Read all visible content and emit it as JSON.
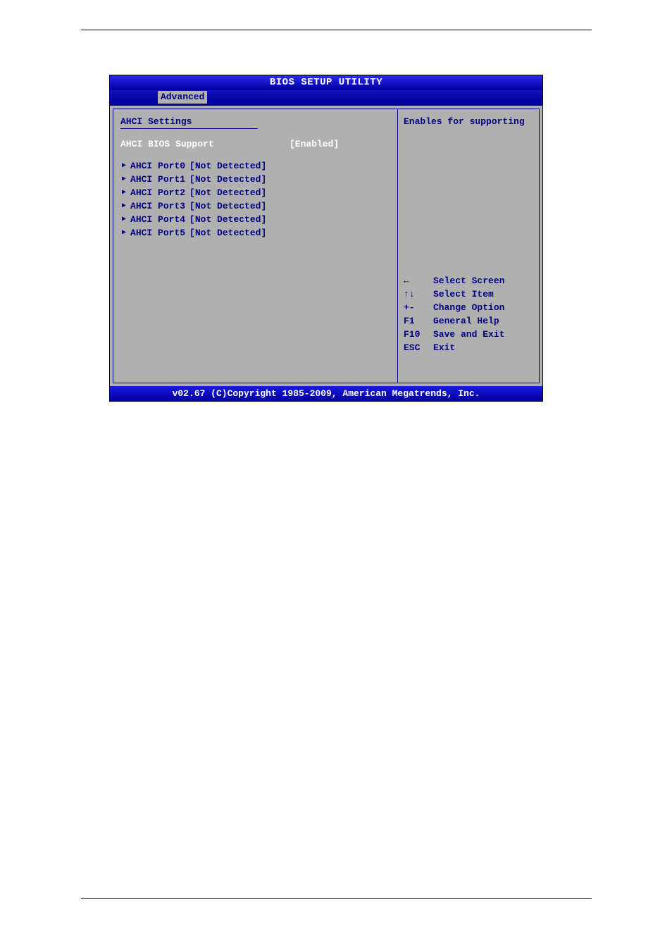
{
  "title": "BIOS SETUP UTILITY",
  "tab": "Advanced",
  "section_title": "AHCI Settings",
  "setting": {
    "label": "AHCI BIOS Support",
    "value": "[Enabled]"
  },
  "ports": [
    {
      "label": "AHCI Port0",
      "status": "[Not Detected]"
    },
    {
      "label": "AHCI Port1",
      "status": "[Not Detected]"
    },
    {
      "label": "AHCI Port2",
      "status": "[Not Detected]"
    },
    {
      "label": "AHCI Port3",
      "status": "[Not Detected]"
    },
    {
      "label": "AHCI Port4",
      "status": "[Not Detected]"
    },
    {
      "label": "AHCI Port5",
      "status": "[Not Detected]"
    }
  ],
  "help_text": "Enables for supporting",
  "keys": [
    {
      "key": "←",
      "action": "Select Screen"
    },
    {
      "key": "↑↓",
      "action": "Select Item"
    },
    {
      "key": "+-",
      "action": "Change Option"
    },
    {
      "key": "F1",
      "action": "General Help"
    },
    {
      "key": "F10",
      "action": "Save and Exit"
    },
    {
      "key": "ESC",
      "action": "Exit"
    }
  ],
  "footer": "v02.67 (C)Copyright 1985-2009, American Megatrends, Inc."
}
